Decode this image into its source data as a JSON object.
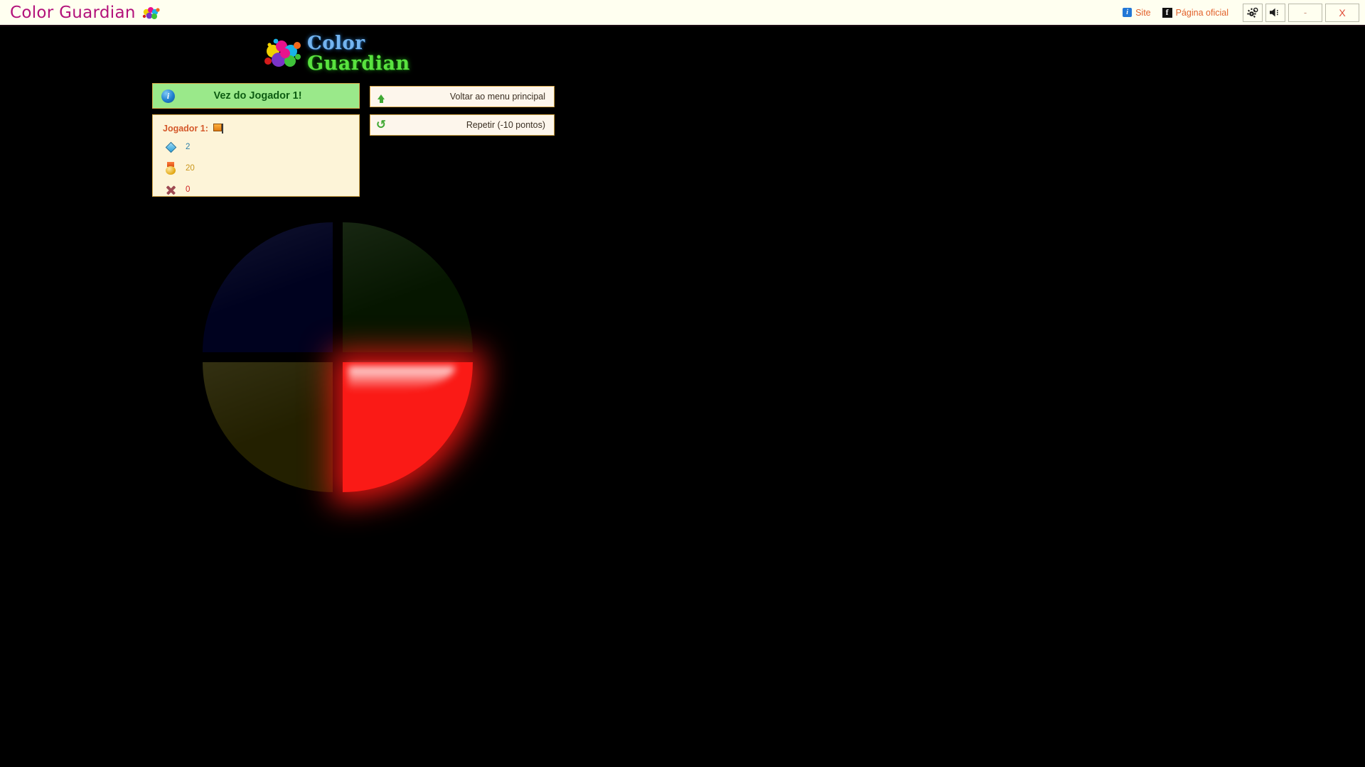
{
  "window": {
    "app_title": "Color Guardian",
    "splat_icon": "paint-splatter-icon",
    "links": [
      {
        "label": "Site",
        "icon": "info-square-icon"
      },
      {
        "label": "Página oficial",
        "icon": "facebook-icon"
      }
    ],
    "buttons": [
      {
        "label": "",
        "icon": "gear-icon",
        "name": "settings-button"
      },
      {
        "label": "",
        "icon": "speaker-icon",
        "name": "sound-button"
      },
      {
        "label": "-",
        "icon": "minimize-icon",
        "name": "minimize-button"
      },
      {
        "label": "X",
        "icon": "close-icon",
        "name": "close-button"
      }
    ]
  },
  "logo": {
    "line1": "Color",
    "line2": "Guardian",
    "splat_icon": "paint-splatter-icon",
    "color1": "#74b4ef",
    "color2": "#59e23f"
  },
  "status": {
    "icon": "info-circle-icon",
    "text": "Vez do Jogador 1!",
    "background": "#9ae98a",
    "text_color": "#0d5c12"
  },
  "player": {
    "name_label": "Jogador 1:",
    "flag_icon": "orange-flag-icon",
    "stats": [
      {
        "icon": "diamond-icon",
        "value": "2",
        "color": "#2c7fa8"
      },
      {
        "icon": "medal-icon",
        "value": "20",
        "color": "#c9951b"
      },
      {
        "icon": "x-mark-icon",
        "value": "0",
        "color": "#cf2222"
      }
    ]
  },
  "menu": {
    "items": [
      {
        "label": "Voltar ao menu principal",
        "icon": "arrow-up-icon"
      },
      {
        "label": "Repetir (-10 pontos)",
        "icon": "refresh-icon"
      }
    ]
  },
  "wheel": {
    "quadrants": [
      {
        "name": "blue",
        "position": "top-left",
        "color": "#00021f",
        "active": "false"
      },
      {
        "name": "green",
        "position": "top-right",
        "color": "#061600",
        "active": "false"
      },
      {
        "name": "yellow",
        "position": "bottom-left",
        "color": "#232000",
        "active": "false"
      },
      {
        "name": "red",
        "position": "bottom-right",
        "color": "#fa1a16",
        "active": "true"
      }
    ]
  }
}
